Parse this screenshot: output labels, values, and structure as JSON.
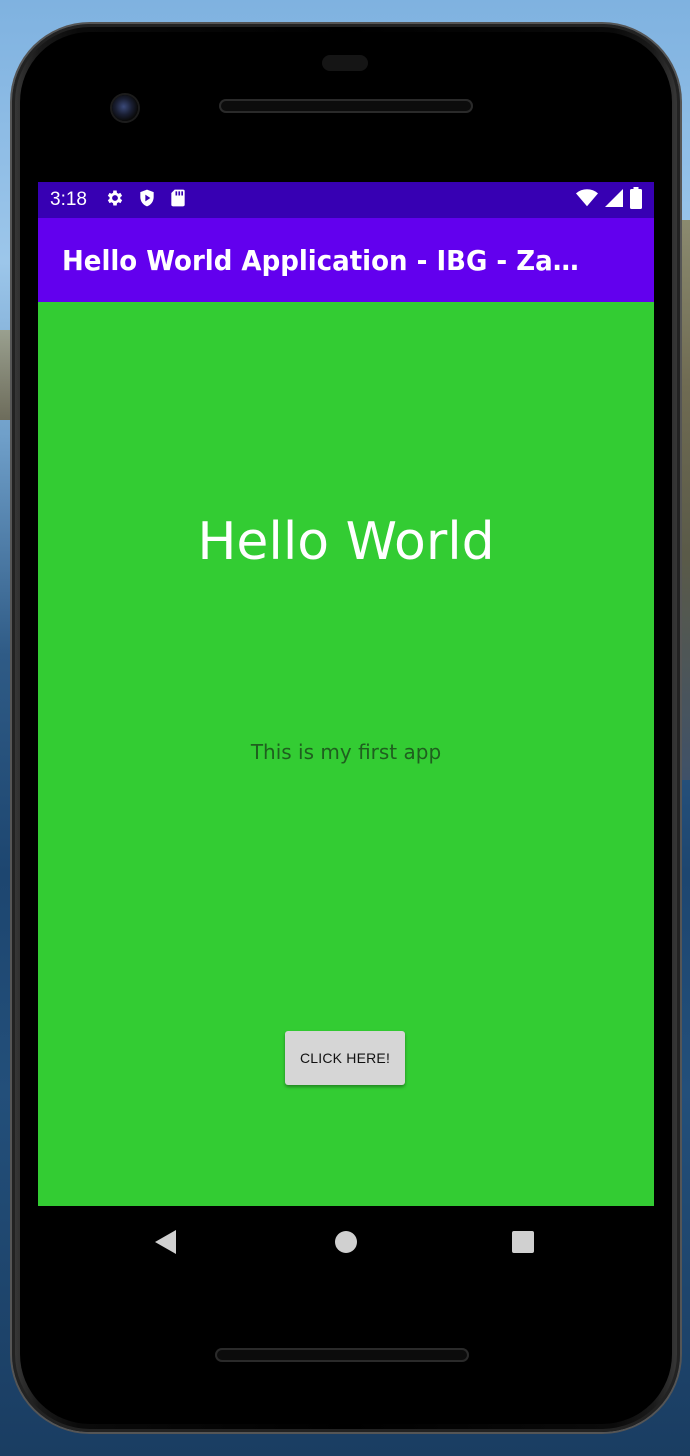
{
  "status_bar": {
    "time": "3:18",
    "left_icons": [
      "gear-icon",
      "shield-play-icon",
      "sd-card-icon"
    ],
    "right_icons": [
      "wifi-icon",
      "signal-icon",
      "battery-icon"
    ],
    "color": "#3700b3"
  },
  "app_bar": {
    "title": "Hello World Application - IBG - Zachary Fallon",
    "color": "#6200ee"
  },
  "main": {
    "background": "#33cc33",
    "heading": "Hello World",
    "subtitle": "This is my first app",
    "button_label": "CLICK HERE!"
  },
  "nav_bar": {
    "buttons": [
      "back-icon",
      "home-icon",
      "recents-icon"
    ]
  }
}
